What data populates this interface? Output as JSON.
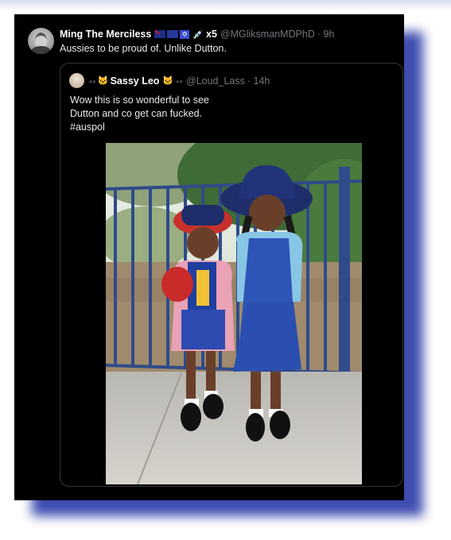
{
  "tweet": {
    "display_name": "Ming The Merciless",
    "emoji_count": "x5",
    "handle": "@MGliksmanMDPhD",
    "time": "· 9h",
    "text": "Aussies to be proud of. Unlike Dutton.",
    "icons": [
      "australia-flag-icon",
      "eu-flag-icon",
      "star-of-david-icon",
      "syringe-icon"
    ]
  },
  "quote": {
    "display_name": "Sassy Leo",
    "handle": "@Loud_Lass",
    "time": "· 14h",
    "lines": [
      "Wow this is so wonderful to see",
      "Dutton and co get can fucked.",
      "#auspol"
    ],
    "icons": [
      "eyes-icon",
      "cat-icon"
    ]
  },
  "colors": {
    "card_bg": "#000000",
    "text": "#e7e9ea",
    "muted": "#71767b",
    "border": "#333639",
    "shadow": "#2b3aa8"
  }
}
